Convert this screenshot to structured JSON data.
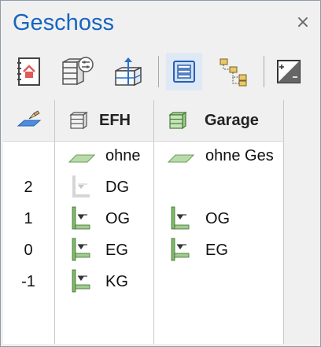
{
  "panel": {
    "title": "Geschoss",
    "close_symbol": "×"
  },
  "toolbar": {
    "buttons": [
      {
        "name": "notebook-house-icon"
      },
      {
        "name": "storey-settings-icon"
      },
      {
        "name": "storey-height-icon"
      },
      {
        "name": "list-view-icon",
        "active": true
      },
      {
        "name": "tree-view-icon"
      },
      {
        "name": "contrast-icon"
      }
    ]
  },
  "columns": {
    "level_header_icon": "pencil-plane-icon",
    "buildings": [
      {
        "label": "EFH"
      },
      {
        "label": "Garage"
      }
    ]
  },
  "rows": [
    {
      "level": "",
      "efh": "ohne",
      "garage": "ohne Ges"
    },
    {
      "level": "2",
      "efh": "DG",
      "garage": ""
    },
    {
      "level": "1",
      "efh": "OG",
      "garage": "OG"
    },
    {
      "level": "0",
      "efh": "EG",
      "garage": "EG"
    },
    {
      "level": "-1",
      "efh": "KG",
      "garage": ""
    }
  ],
  "colors": {
    "title": "#1565c0",
    "storey_green": "#7fba6a",
    "storey_green_light": "#b9dba9",
    "storey_gray": "#c8c8c8",
    "list_active_bg": "#dfe9f5"
  }
}
